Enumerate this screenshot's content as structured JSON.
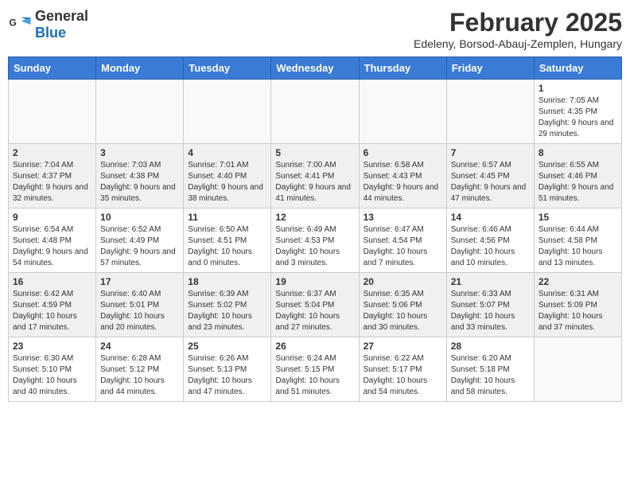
{
  "header": {
    "logo_general": "General",
    "logo_blue": "Blue",
    "title": "February 2025",
    "subtitle": "Edeleny, Borsod-Abauj-Zemplen, Hungary"
  },
  "weekdays": [
    "Sunday",
    "Monday",
    "Tuesday",
    "Wednesday",
    "Thursday",
    "Friday",
    "Saturday"
  ],
  "weeks": [
    [
      {
        "day": "",
        "info": ""
      },
      {
        "day": "",
        "info": ""
      },
      {
        "day": "",
        "info": ""
      },
      {
        "day": "",
        "info": ""
      },
      {
        "day": "",
        "info": ""
      },
      {
        "day": "",
        "info": ""
      },
      {
        "day": "1",
        "info": "Sunrise: 7:05 AM\nSunset: 4:35 PM\nDaylight: 9 hours and 29 minutes."
      }
    ],
    [
      {
        "day": "2",
        "info": "Sunrise: 7:04 AM\nSunset: 4:37 PM\nDaylight: 9 hours and 32 minutes."
      },
      {
        "day": "3",
        "info": "Sunrise: 7:03 AM\nSunset: 4:38 PM\nDaylight: 9 hours and 35 minutes."
      },
      {
        "day": "4",
        "info": "Sunrise: 7:01 AM\nSunset: 4:40 PM\nDaylight: 9 hours and 38 minutes."
      },
      {
        "day": "5",
        "info": "Sunrise: 7:00 AM\nSunset: 4:41 PM\nDaylight: 9 hours and 41 minutes."
      },
      {
        "day": "6",
        "info": "Sunrise: 6:58 AM\nSunset: 4:43 PM\nDaylight: 9 hours and 44 minutes."
      },
      {
        "day": "7",
        "info": "Sunrise: 6:57 AM\nSunset: 4:45 PM\nDaylight: 9 hours and 47 minutes."
      },
      {
        "day": "8",
        "info": "Sunrise: 6:55 AM\nSunset: 4:46 PM\nDaylight: 9 hours and 51 minutes."
      }
    ],
    [
      {
        "day": "9",
        "info": "Sunrise: 6:54 AM\nSunset: 4:48 PM\nDaylight: 9 hours and 54 minutes."
      },
      {
        "day": "10",
        "info": "Sunrise: 6:52 AM\nSunset: 4:49 PM\nDaylight: 9 hours and 57 minutes."
      },
      {
        "day": "11",
        "info": "Sunrise: 6:50 AM\nSunset: 4:51 PM\nDaylight: 10 hours and 0 minutes."
      },
      {
        "day": "12",
        "info": "Sunrise: 6:49 AM\nSunset: 4:53 PM\nDaylight: 10 hours and 3 minutes."
      },
      {
        "day": "13",
        "info": "Sunrise: 6:47 AM\nSunset: 4:54 PM\nDaylight: 10 hours and 7 minutes."
      },
      {
        "day": "14",
        "info": "Sunrise: 6:46 AM\nSunset: 4:56 PM\nDaylight: 10 hours and 10 minutes."
      },
      {
        "day": "15",
        "info": "Sunrise: 6:44 AM\nSunset: 4:58 PM\nDaylight: 10 hours and 13 minutes."
      }
    ],
    [
      {
        "day": "16",
        "info": "Sunrise: 6:42 AM\nSunset: 4:59 PM\nDaylight: 10 hours and 17 minutes."
      },
      {
        "day": "17",
        "info": "Sunrise: 6:40 AM\nSunset: 5:01 PM\nDaylight: 10 hours and 20 minutes."
      },
      {
        "day": "18",
        "info": "Sunrise: 6:39 AM\nSunset: 5:02 PM\nDaylight: 10 hours and 23 minutes."
      },
      {
        "day": "19",
        "info": "Sunrise: 6:37 AM\nSunset: 5:04 PM\nDaylight: 10 hours and 27 minutes."
      },
      {
        "day": "20",
        "info": "Sunrise: 6:35 AM\nSunset: 5:06 PM\nDaylight: 10 hours and 30 minutes."
      },
      {
        "day": "21",
        "info": "Sunrise: 6:33 AM\nSunset: 5:07 PM\nDaylight: 10 hours and 33 minutes."
      },
      {
        "day": "22",
        "info": "Sunrise: 6:31 AM\nSunset: 5:09 PM\nDaylight: 10 hours and 37 minutes."
      }
    ],
    [
      {
        "day": "23",
        "info": "Sunrise: 6:30 AM\nSunset: 5:10 PM\nDaylight: 10 hours and 40 minutes."
      },
      {
        "day": "24",
        "info": "Sunrise: 6:28 AM\nSunset: 5:12 PM\nDaylight: 10 hours and 44 minutes."
      },
      {
        "day": "25",
        "info": "Sunrise: 6:26 AM\nSunset: 5:13 PM\nDaylight: 10 hours and 47 minutes."
      },
      {
        "day": "26",
        "info": "Sunrise: 6:24 AM\nSunset: 5:15 PM\nDaylight: 10 hours and 51 minutes."
      },
      {
        "day": "27",
        "info": "Sunrise: 6:22 AM\nSunset: 5:17 PM\nDaylight: 10 hours and 54 minutes."
      },
      {
        "day": "28",
        "info": "Sunrise: 6:20 AM\nSunset: 5:18 PM\nDaylight: 10 hours and 58 minutes."
      },
      {
        "day": "",
        "info": ""
      }
    ]
  ]
}
